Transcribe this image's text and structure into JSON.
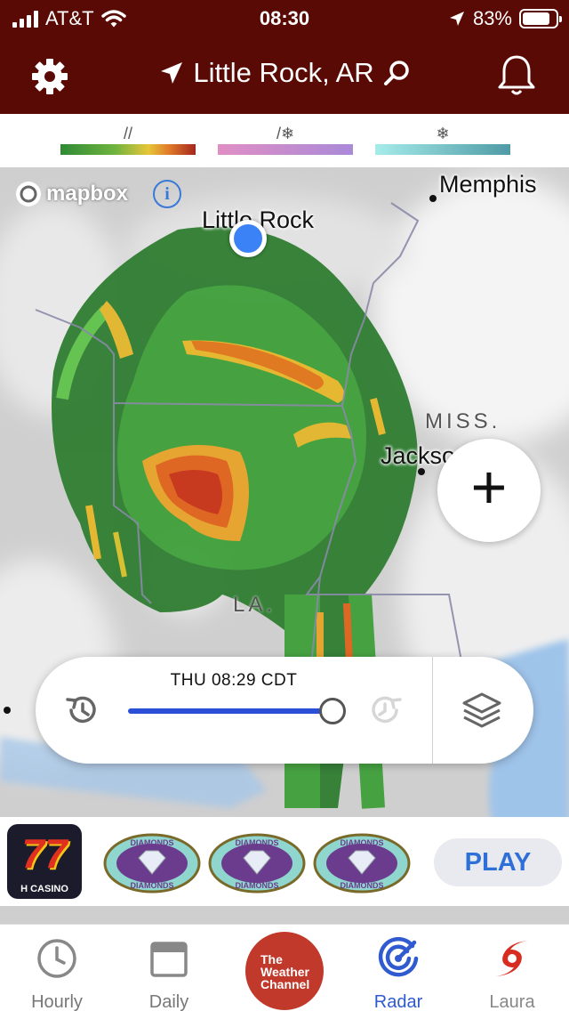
{
  "status_bar": {
    "carrier": "AT&T",
    "time": "08:30",
    "battery": "83%",
    "battery_level": 0.83
  },
  "header": {
    "location": "Little Rock, AR",
    "icons": [
      "gear-icon",
      "location-arrow-icon",
      "search-icon",
      "bell-icon"
    ]
  },
  "legend": {
    "items": [
      {
        "type": "rain",
        "symbol": "//",
        "colors": [
          "#3c8f3c",
          "#e0c036",
          "#c0392b"
        ]
      },
      {
        "type": "mix",
        "symbol": "/❄",
        "colors": [
          "#d98cc2",
          "#a98ad8"
        ]
      },
      {
        "type": "snow",
        "symbol": "❄",
        "colors": [
          "#9ee8e6",
          "#4a9aa4"
        ]
      }
    ]
  },
  "map": {
    "attribution": "mapbox",
    "labels": {
      "memphis": "Memphis",
      "little_rock": "Little Rock",
      "miss": "MISS.",
      "jackson": "Jackson",
      "la": "LA."
    },
    "zoom_label": "+"
  },
  "timeline": {
    "time": "THU 08:29 CDT",
    "progress": 1.0
  },
  "ad": {
    "brand": "H CASINO",
    "sevens": "77",
    "diamond_text": "DIAMONDS",
    "play": "PLAY"
  },
  "tabs": [
    {
      "label": "Hourly",
      "icon": "clock-icon"
    },
    {
      "label": "Daily",
      "icon": "calendar-icon"
    },
    {
      "label": "The Weather Channel",
      "icon": "twc-logo"
    },
    {
      "label": "Radar",
      "icon": "radar-icon"
    },
    {
      "label": "Laura",
      "icon": "hurricane-icon"
    }
  ],
  "colors": {
    "header_bg": "#5a0a05",
    "accent_blue": "#2f5ad0",
    "twc_red": "#c0392b"
  }
}
